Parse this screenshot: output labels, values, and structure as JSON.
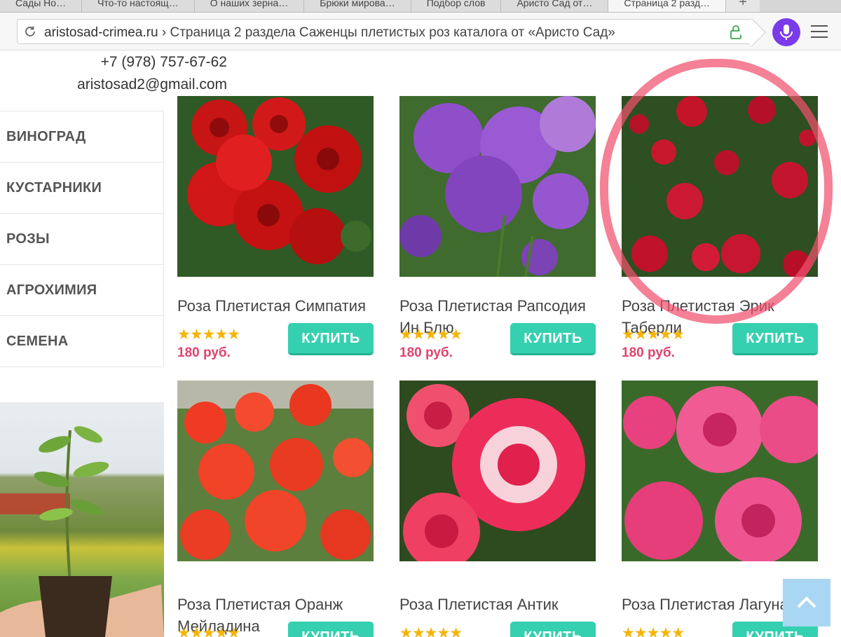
{
  "browser": {
    "tabs": [
      {
        "label": "Сады Но…"
      },
      {
        "label": "Что-то настоящ…"
      },
      {
        "label": "О наших зерна…"
      },
      {
        "label": "Брюки мирова…"
      },
      {
        "label": "Подбор слов"
      },
      {
        "label": "Аристо Сад от…"
      },
      {
        "label": "Страница 2 разд…",
        "active": true
      }
    ],
    "new_tab": "+",
    "url_domain": "aristosad-crimea.ru",
    "url_rest": " › Страница 2 раздела Саженцы плетистых роз каталога от «Аристо Сад»",
    "accent": "#7b3bea"
  },
  "contact": {
    "phone": "+7 (978) 757-67-62",
    "email": "aristosad2@gmail.com"
  },
  "sidebar": {
    "categories": [
      {
        "label": "ВИНОГРАД"
      },
      {
        "label": "КУСТАРНИКИ"
      },
      {
        "label": "РОЗЫ"
      },
      {
        "label": "АГРОХИМИЯ"
      },
      {
        "label": "СЕМЕНА"
      }
    ]
  },
  "products": [
    {
      "name": "Роза Плетистая Симпатия",
      "rating": 5,
      "stars": "★★★★★",
      "price": "180 руб.",
      "buy_label": "КУПИТЬ"
    },
    {
      "name": "Роза Плетистая Рапсодия Ин Блю",
      "rating": 5,
      "stars": "★★★★★",
      "price": "180 руб.",
      "buy_label": "КУПИТЬ"
    },
    {
      "name": "Роза Плетистая Эрик Таберли",
      "rating": 5,
      "stars": "★★★★★",
      "price": "180 руб.",
      "buy_label": "КУПИТЬ"
    },
    {
      "name": "Роза Плетистая Оранж Мейладина",
      "rating": 5,
      "stars": "★★★★★",
      "buy_label": "КУПИТЬ"
    },
    {
      "name": "Роза Плетистая Антик",
      "rating": 5,
      "stars": "★★★★★",
      "buy_label": "КУПИТЬ"
    },
    {
      "name": "Роза Плетистая Лагуна",
      "rating": 5,
      "stars": "★★★★★",
      "buy_label": "КУПИТЬ"
    }
  ],
  "colors": {
    "buy_button": "#35d0b0",
    "price": "#e0436f",
    "stars": "#f6b400",
    "annotation_circle": "#f0506e"
  },
  "icons": {
    "reload": "reload-icon",
    "lock": "lock-icon",
    "mic": "microphone-icon",
    "menu": "hamburger-menu-icon",
    "scroll_top": "chevron-up-icon"
  }
}
